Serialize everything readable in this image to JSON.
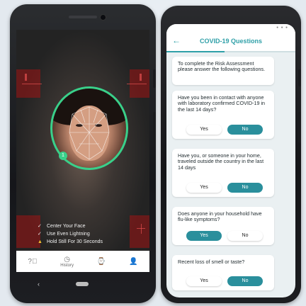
{
  "camera_screen": {
    "checklist": [
      {
        "icon": "check-icon",
        "text": "Center Your Face"
      },
      {
        "icon": "check-icon",
        "text": "Use Even Lightning"
      },
      {
        "icon": "warning-icon",
        "text": "Hold Still For 30 Seconds"
      }
    ],
    "face_badge": "1",
    "nav": {
      "items": [
        {
          "name": "help",
          "icon": "help-icon",
          "label": ""
        },
        {
          "name": "history",
          "icon": "clock-icon",
          "label": "History"
        },
        {
          "name": "watch",
          "icon": "watch-icon",
          "label": ""
        },
        {
          "name": "profile",
          "icon": "person-icon",
          "label": ""
        }
      ]
    }
  },
  "questions_screen": {
    "title": "COVID-19 Questions",
    "progress": 0.45,
    "intro": "To complete the Risk Assessment please answer the following questions.",
    "questions": [
      {
        "text": "Have you been in contact with anyone with laboratory confirmed COVID-19 in the last 14 days?",
        "yes": "Yes",
        "no": "No",
        "selected": "No"
      },
      {
        "text": "Have you, or someone in your home, traveled outside the country in the last 14 days",
        "yes": "Yes",
        "no": "No",
        "selected": "No"
      },
      {
        "text": "Does anyone in your household have flu-like symptoms?",
        "yes": "Yes",
        "no": "No",
        "selected": "Yes"
      },
      {
        "text": "Recent loss of smell or taste?",
        "yes": "Yes",
        "no": "No",
        "selected": "No"
      }
    ]
  },
  "colors": {
    "accent": "#2fa0a8",
    "selected_button": "#2a8f9c",
    "face_ring": "#39d08a",
    "warning": "#f2c230"
  }
}
